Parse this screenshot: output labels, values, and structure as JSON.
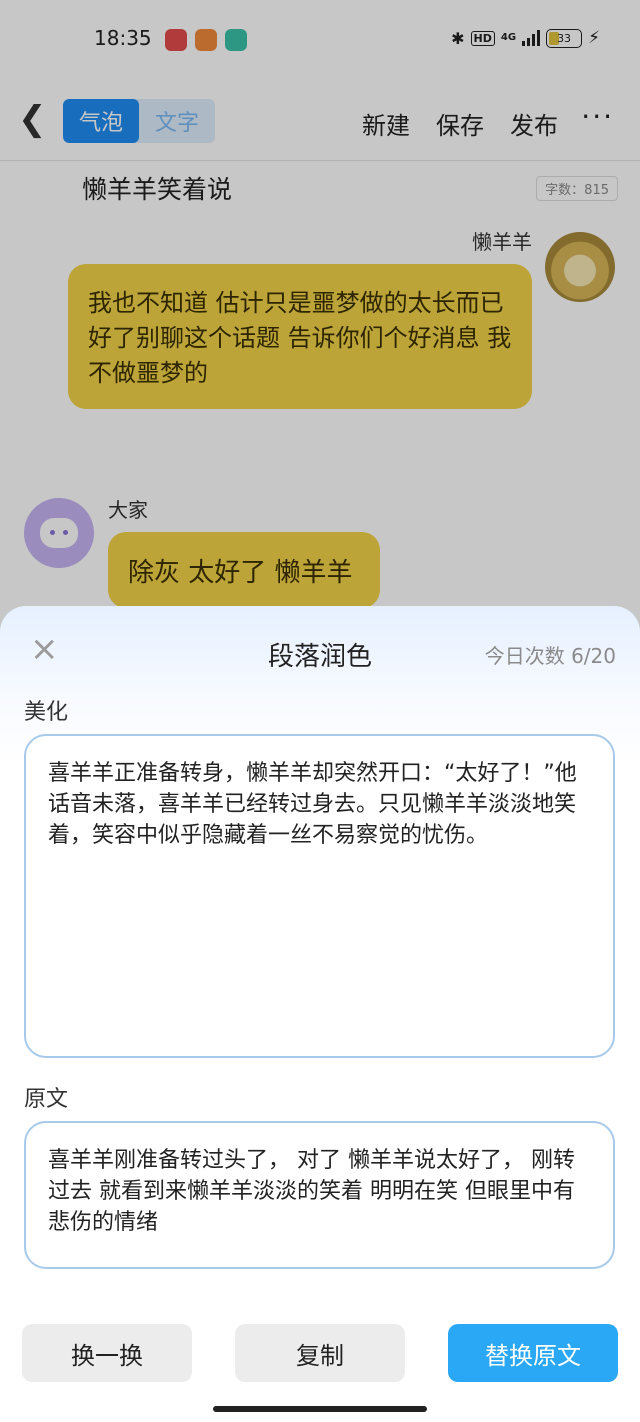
{
  "status": {
    "time": "18:35",
    "hd": "HD",
    "net": "4G",
    "battery": "33"
  },
  "topbar": {
    "tab_bubble": "气泡",
    "tab_text": "文字",
    "new_label": "新建",
    "save_label": "保存",
    "publish_label": "发布",
    "more_label": "···"
  },
  "story": {
    "title": "懒羊羊笑着说",
    "word_count": "字数：815"
  },
  "messages": [
    {
      "speaker": "懒羊羊",
      "text": "我也不知道 估计只是噩梦做的太长而已 好了别聊这个话题 告诉你们个好消息 我不做噩梦的"
    },
    {
      "speaker": "大家",
      "text": "除灰 太好了 懒羊羊"
    }
  ],
  "sheet": {
    "close_label": "×",
    "title": "段落润色",
    "quota": "今日次数 6/20",
    "beautified_label": "美化",
    "beautified_text": "喜羊羊正准备转身，懒羊羊却突然开口：“太好了！”他话音未落，喜羊羊已经转过身去。只见懒羊羊淡淡地笑着，笑容中似乎隐藏着一丝不易察觉的忧伤。",
    "original_label": "原文",
    "original_text": "喜羊羊刚准备转过头了， 对了 懒羊羊说太好了， 刚转过去 就看到来懒羊羊淡淡的笑着 明明在笑 但眼里中有悲伤的情绪",
    "btn_refresh": "换一换",
    "btn_copy": "复制",
    "btn_replace": "替换原文"
  }
}
